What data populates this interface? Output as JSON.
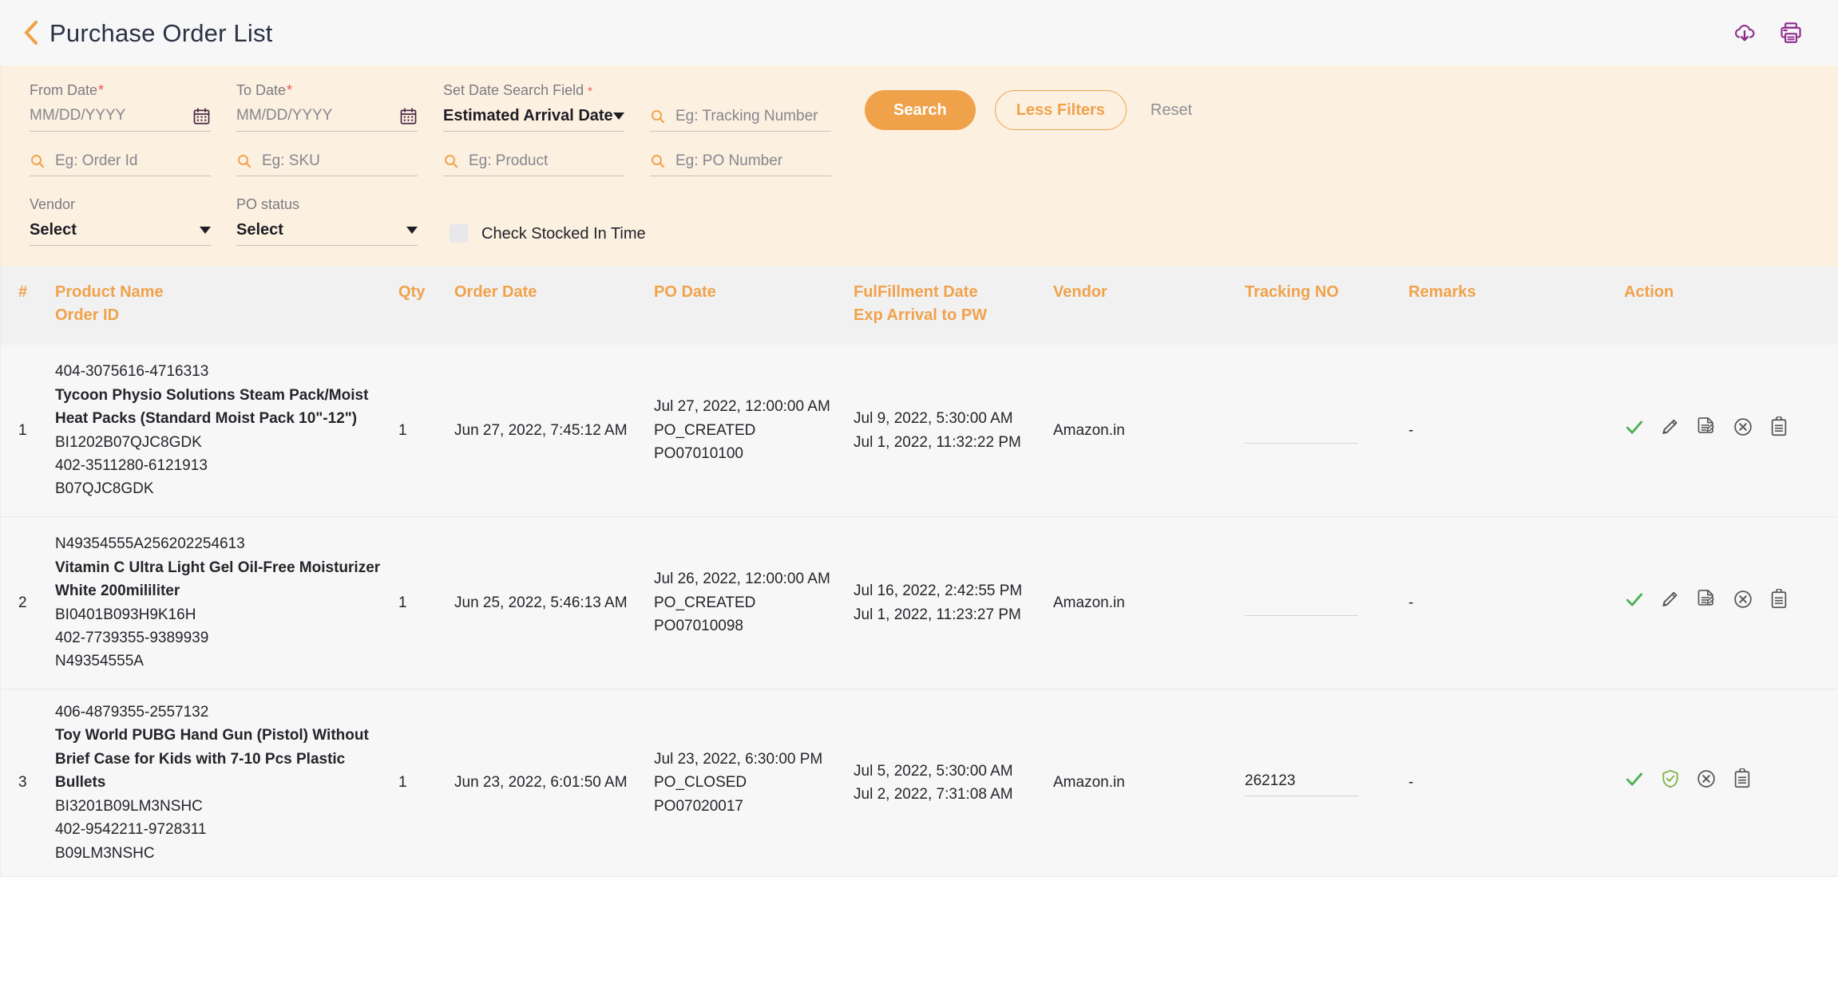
{
  "header": {
    "title": "Purchase Order List",
    "back_icon": "chevron-left-icon",
    "download_icon": "cloud-download-icon",
    "print_icon": "printer-icon"
  },
  "colors": {
    "accent": "#f0a24b",
    "filter_bg": "#fcf0e1",
    "header_bg": "#f1f1f1",
    "required": "#ef5350",
    "icon_purple": "#8e2b8e",
    "success_green": "#4caf50"
  },
  "filters": {
    "from_date": {
      "label": "From Date",
      "required": true,
      "placeholder": "MM/DD/YYYY",
      "value": "",
      "icon": "calendar-icon"
    },
    "to_date": {
      "label": "To Date",
      "required": true,
      "placeholder": "MM/DD/YYYY",
      "value": "",
      "icon": "calendar-icon"
    },
    "date_search_field": {
      "label": "Set Date Search Field",
      "required": true,
      "value": "Estimated Arrival Date"
    },
    "tracking_number": {
      "placeholder": "Eg: Tracking Number",
      "value": ""
    },
    "order_id": {
      "placeholder": "Eg: Order Id",
      "value": ""
    },
    "sku": {
      "placeholder": "Eg: SKU",
      "value": ""
    },
    "product": {
      "placeholder": "Eg: Product",
      "value": ""
    },
    "po_number": {
      "placeholder": "Eg: PO Number",
      "value": ""
    },
    "vendor": {
      "label": "Vendor",
      "value": "Select"
    },
    "po_status": {
      "label": "PO status",
      "value": "Select"
    },
    "check_stocked": {
      "label": "Check Stocked In Time",
      "checked": false
    },
    "buttons": {
      "search": "Search",
      "less_filters": "Less Filters",
      "reset": "Reset"
    }
  },
  "table": {
    "columns": {
      "index": "#",
      "product_name": "Product Name",
      "order_id": "Order ID",
      "qty": "Qty",
      "order_date": "Order Date",
      "po_date": "PO Date",
      "fulfillment_date": "FulFillment Date",
      "exp_arrival": "Exp Arrival to PW",
      "vendor": "Vendor",
      "tracking_no": "Tracking NO",
      "remarks": "Remarks",
      "action": "Action"
    },
    "rows": [
      {
        "index": "1",
        "order_id_top": "404-3075616-4716313",
        "product_name": "Tycoon Physio Solutions Steam Pack/Moist Heat Packs (Standard Moist Pack 10\"-12\")",
        "sku": "BI1202B07QJC8GDK",
        "order_ref": "402-3511280-6121913",
        "asin": "B07QJC8GDK",
        "qty": "1",
        "order_date": "Jun 27, 2022, 7:45:12 AM",
        "po_date": "Jul 27, 2022, 12:00:00 AM",
        "po_status": "PO_CREATED",
        "po_number": "PO07010100",
        "fulfillment_date": "Jul 9, 2022, 5:30:00 AM",
        "exp_arrival": "Jul 1, 2022, 11:32:22 PM",
        "vendor": "Amazon.in",
        "tracking_no": "",
        "remarks": "-",
        "actions": [
          "check-icon",
          "pencil-icon",
          "document-edit-icon",
          "circle-close-icon",
          "clipboard-icon"
        ]
      },
      {
        "index": "2",
        "order_id_top": "N49354555A256202254613",
        "product_name": "Vitamin C Ultra Light Gel Oil-Free Moisturizer White 200mililiter",
        "sku": "BI0401B093H9K16H",
        "order_ref": "402-7739355-9389939",
        "asin": "N49354555A",
        "qty": "1",
        "order_date": "Jun 25, 2022, 5:46:13 AM",
        "po_date": "Jul 26, 2022, 12:00:00 AM",
        "po_status": "PO_CREATED",
        "po_number": "PO07010098",
        "fulfillment_date": "Jul 16, 2022, 2:42:55 PM",
        "exp_arrival": "Jul 1, 2022, 11:23:27 PM",
        "vendor": "Amazon.in",
        "tracking_no": "",
        "remarks": "-",
        "actions": [
          "check-icon",
          "pencil-icon",
          "document-edit-icon",
          "circle-close-icon",
          "clipboard-icon"
        ]
      },
      {
        "index": "3",
        "order_id_top": "406-4879355-2557132",
        "product_name": "Toy World PUBG Hand Gun (Pistol) Without Brief Case for Kids with 7-10 Pcs Plastic Bullets",
        "sku": "BI3201B09LM3NSHC",
        "order_ref": "402-9542211-9728311",
        "asin": "B09LM3NSHC",
        "qty": "1",
        "order_date": "Jun 23, 2022, 6:01:50 AM",
        "po_date": "Jul 23, 2022, 6:30:00 PM",
        "po_status": "PO_CLOSED",
        "po_number": "PO07020017",
        "fulfillment_date": "Jul 5, 2022, 5:30:00 AM",
        "exp_arrival": "Jul 2, 2022, 7:31:08 AM",
        "vendor": "Amazon.in",
        "tracking_no": "262123",
        "remarks": "-",
        "actions": [
          "check-icon",
          "shield-check-icon",
          "circle-close-icon",
          "clipboard-icon"
        ]
      }
    ]
  }
}
